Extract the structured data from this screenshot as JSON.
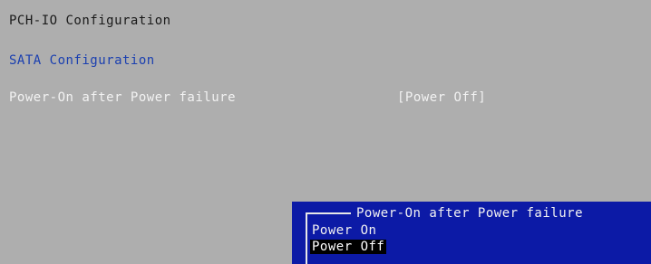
{
  "page": {
    "title": "PCH-IO Configuration"
  },
  "menu": {
    "submenu_label": "SATA Configuration"
  },
  "setting": {
    "label": "Power-On after Power failure",
    "value": "[Power Off]"
  },
  "popup": {
    "title": "Power-On after Power failure",
    "options": [
      {
        "label": "Power On",
        "selected": false
      },
      {
        "label": "Power Off",
        "selected": true
      }
    ]
  },
  "colors": {
    "background": "#aeaeae",
    "title_text": "#1a1a1a",
    "submenu_text": "#1a3fb0",
    "setting_text": "#f2f2f2",
    "popup_background": "#0c1aa6",
    "selected_option_background": "#000000"
  }
}
